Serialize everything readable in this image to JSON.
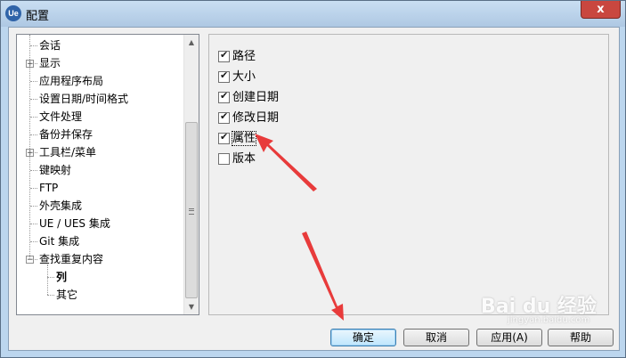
{
  "window": {
    "title": "配置",
    "app_icon_text": "Ue",
    "close_glyph": "x"
  },
  "tree": {
    "items": [
      {
        "label": "会话",
        "level": 0,
        "expandable": false
      },
      {
        "label": "显示",
        "level": 0,
        "expandable": true
      },
      {
        "label": "应用程序布局",
        "level": 0,
        "expandable": false
      },
      {
        "label": "设置日期/时间格式",
        "level": 0,
        "expandable": false
      },
      {
        "label": "文件处理",
        "level": 0,
        "expandable": false
      },
      {
        "label": "备份并保存",
        "level": 0,
        "expandable": false
      },
      {
        "label": "工具栏/菜单",
        "level": 0,
        "expandable": true
      },
      {
        "label": "键映射",
        "level": 0,
        "expandable": false
      },
      {
        "label": "FTP",
        "level": 0,
        "expandable": false
      },
      {
        "label": "外壳集成",
        "level": 0,
        "expandable": false
      },
      {
        "label": "UE / UES 集成",
        "level": 0,
        "expandable": false
      },
      {
        "label": "Git 集成",
        "level": 0,
        "expandable": false
      },
      {
        "label": "查找重复内容",
        "level": 0,
        "expandable": true,
        "expanded": true
      },
      {
        "label": "列",
        "level": 1,
        "selected": true
      },
      {
        "label": "其它",
        "level": 1
      }
    ],
    "expand_glyph": "+",
    "collapse_glyph": "−"
  },
  "scrollbar": {
    "up_glyph": "▲",
    "down_glyph": "▼"
  },
  "options": [
    {
      "label": "路径",
      "checked": true
    },
    {
      "label": "大小",
      "checked": true
    },
    {
      "label": "创建日期",
      "checked": true
    },
    {
      "label": "修改日期",
      "checked": true
    },
    {
      "label": "属性",
      "checked": true,
      "focused": true
    },
    {
      "label": "版本",
      "checked": false
    }
  ],
  "buttons": {
    "ok": "确定",
    "cancel": "取消",
    "apply": "应用(A)",
    "help": "帮助"
  },
  "watermark": {
    "text": "Bai du 经验",
    "sub": "jingyan.baidu.com"
  },
  "colors": {
    "annotation_arrow": "#e83b3b",
    "default_button_border": "#3c7fb1"
  }
}
